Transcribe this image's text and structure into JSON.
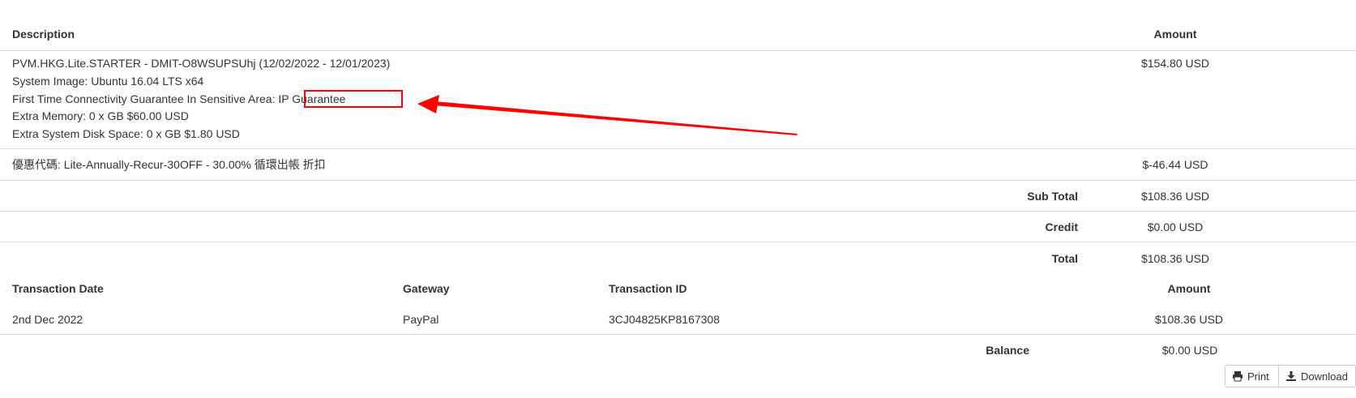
{
  "items": {
    "header": {
      "description": "Description",
      "amount": "Amount"
    },
    "product": {
      "lines": [
        "PVM.HKG.Lite.STARTER - DMIT-O8WSUPSUhj (12/02/2022 - 12/01/2023)",
        "System Image: Ubuntu 16.04 LTS x64",
        "First Time Connectivity Guarantee In Sensitive Area: IP Guarantee",
        "Extra Memory: 0 x GB $60.00 USD",
        "Extra System Disk Space: 0 x GB $1.80 USD"
      ],
      "amount": "$154.80 USD"
    },
    "promo": {
      "text": "優惠代碼: Lite-Annually-Recur-30OFF - 30.00% 循環出帳 折扣",
      "amount": "$-46.44 USD"
    },
    "sub_total": {
      "label": "Sub Total",
      "amount": "$108.36 USD"
    },
    "credit": {
      "label": "Credit",
      "amount": "$0.00 USD"
    },
    "total": {
      "label": "Total",
      "amount": "$108.36 USD"
    }
  },
  "transactions": {
    "headers": {
      "date": "Transaction Date",
      "gateway": "Gateway",
      "id": "Transaction ID",
      "amount": "Amount"
    },
    "rows": [
      {
        "date": "2nd Dec 2022",
        "gateway": "PayPal",
        "id": "3CJ04825KP8167308",
        "amount": "$108.36 USD"
      }
    ],
    "balance": {
      "label": "Balance",
      "amount": "$0.00 USD"
    }
  },
  "actions": {
    "print": "Print",
    "download": "Download"
  },
  "colors": {
    "annotation": "#ff0000",
    "border": "#dddddd",
    "text": "#333333"
  },
  "icons": {
    "print": "printer-icon",
    "download": "download-icon"
  }
}
